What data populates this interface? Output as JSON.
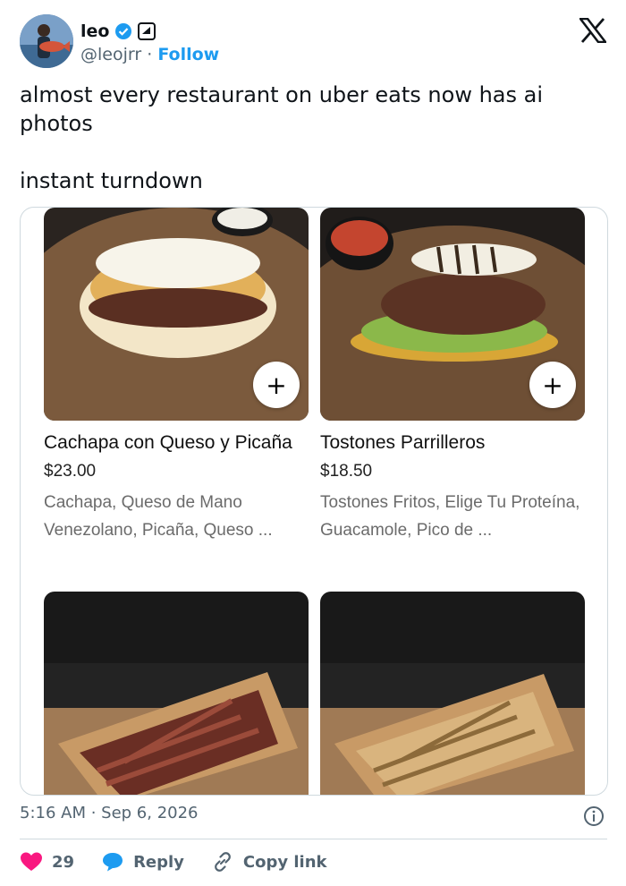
{
  "author": {
    "name": "leo",
    "handle": "@leojrr",
    "separator": "·",
    "follow_label": "Follow"
  },
  "tweet": {
    "text": "almost every restaurant on uber eats now has ai photos\n\ninstant turndown"
  },
  "menu_items": [
    {
      "title": "Cachapa con Queso y Picaña",
      "price": "$23.00",
      "description": "Cachapa, Queso de Mano Venezolano, Picaña, Queso ...",
      "add_label": "+"
    },
    {
      "title": "Tostones Parrilleros",
      "price": "$18.50",
      "description": "Tostones Fritos, Elige Tu Proteína, Guacamole, Pico de ...",
      "add_label": "+"
    },
    {
      "title": "",
      "price": "",
      "description": ""
    },
    {
      "title": "",
      "price": "",
      "description": ""
    }
  ],
  "footer": {
    "timestamp": "5:16 AM · Sep 6, 2026",
    "likes": "29",
    "reply_label": "Reply",
    "copy_link_label": "Copy link"
  },
  "colors": {
    "accent": "#1d9bf0",
    "like": "#f91880",
    "text_secondary": "#536471"
  }
}
